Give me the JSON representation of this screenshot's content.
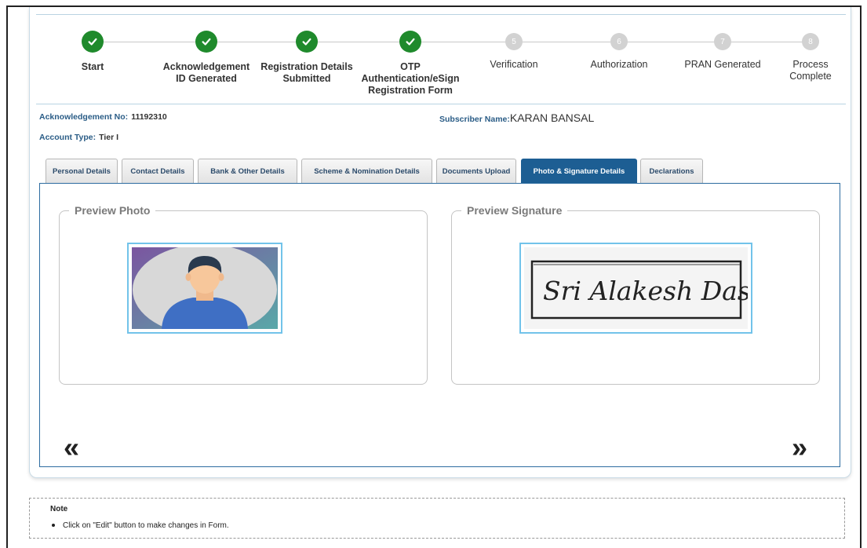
{
  "stepper": {
    "steps": [
      {
        "num": "1",
        "label_lines": [
          "Start"
        ],
        "status": "done"
      },
      {
        "num": "2",
        "label_lines": [
          "Acknowledgement",
          "ID Generated"
        ],
        "status": "done"
      },
      {
        "num": "3",
        "label_lines": [
          "Registration Details",
          "Submitted"
        ],
        "status": "done"
      },
      {
        "num": "4",
        "label_lines": [
          "OTP",
          "Authentication/eSign",
          "Registration Form"
        ],
        "status": "done"
      },
      {
        "num": "5",
        "label_lines": [
          "Verification"
        ],
        "status": "pending"
      },
      {
        "num": "6",
        "label_lines": [
          "Authorization"
        ],
        "status": "pending"
      },
      {
        "num": "7",
        "label_lines": [
          "PRAN Generated"
        ],
        "status": "pending"
      },
      {
        "num": "8",
        "label_lines": [
          "Process",
          "Complete"
        ],
        "status": "pending"
      }
    ],
    "colors": {
      "done": "#1f8a2c",
      "pending": "#d2d2d2"
    }
  },
  "info": {
    "ack_label": "Acknowledgement No:",
    "ack_value": "11192310",
    "subscriber_label": "Subscriber Name:",
    "subscriber_value": "KARAN BANSAL",
    "account_label": "Account Type:",
    "account_value": "Tier I"
  },
  "tabs": [
    {
      "label": "Personal Details",
      "active": false
    },
    {
      "label": "Contact Details",
      "active": false
    },
    {
      "label": "Bank & Other Details",
      "active": false
    },
    {
      "label": "Scheme & Nomination Details",
      "active": false
    },
    {
      "label": "Documents Upload",
      "active": false
    },
    {
      "label": "Photo & Signature Details",
      "active": true
    },
    {
      "label": "Declarations",
      "active": false
    }
  ],
  "preview": {
    "photo_legend": "Preview Photo",
    "signature_legend": "Preview Signature",
    "signature_text": "Sri Alakesh Das."
  },
  "nav": {
    "prev_glyph": "«",
    "next_glyph": "»"
  },
  "note": {
    "title": "Note",
    "items": [
      "Click on \"Edit\" button to make changes in Form."
    ]
  },
  "theme": {
    "accent": "#1d5e93",
    "border": "#2d6ca0",
    "highlight": "#72c3ea"
  }
}
